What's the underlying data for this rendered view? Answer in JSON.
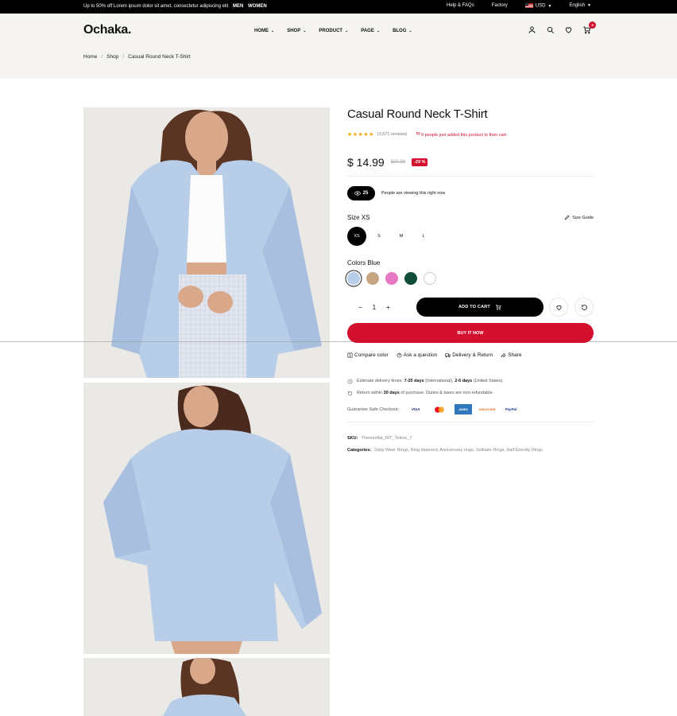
{
  "topbar": {
    "promo": "Up to 50% off Lorem ipsum dolor sit amet, consectetur adipiscing elit",
    "men": "MEN",
    "women": "WOMEN",
    "help": "Help & FAQs",
    "factory": "Factory",
    "currency": "USD",
    "language": "English"
  },
  "header": {
    "logo": "Ochaka.",
    "nav": [
      "HOME",
      "SHOP",
      "PRODUCT",
      "PAGE",
      "BLOG"
    ],
    "cart_count": "3"
  },
  "breadcrumb": [
    "Home",
    "Shop",
    "Casual Round Neck T-Shirt"
  ],
  "product": {
    "title": "Casual Round Neck T-Shirt",
    "stars": "★★★★★",
    "reviews": "(3,671 reviews)",
    "added": "9 people just added this product to their cart",
    "price": "$ 14.99",
    "old_price": "$39.99",
    "discount": "-29 %",
    "viewers": "25",
    "viewing_text": "People are viewing this right now",
    "size_label": "Size XS",
    "size_guide": "Size Guide",
    "sizes": [
      "XS",
      "S",
      "M",
      "L"
    ],
    "selected_size": "XS",
    "color_label": "Colors Blue",
    "colors": [
      "#b8cde8",
      "#c8a582",
      "#e578c2",
      "#114c38",
      "#ffffff"
    ],
    "selected_color": "#b8cde8",
    "quantity": "1",
    "add_to_cart": "ADD TO CART",
    "buy_now": "BUY IT NOW",
    "links": [
      "Compare color",
      "Ask a question",
      "Delivery & Return",
      "Share"
    ],
    "delivery_line1_pre": "Estimate delivery times:",
    "delivery_intl": "7-20 days",
    "delivery_intl_suffix": "(International),",
    "delivery_us": "2-6 days",
    "delivery_us_suffix": "(United States).",
    "return_pre": "Return within",
    "return_days": "30 days",
    "return_post": "of purchase. Duties & taxes are non-refundable.",
    "checkout_label": "Guarantee Safe Checkout:",
    "payments": [
      "VISA",
      "mastercard",
      "AMEX",
      "DISCOVER",
      "PayPal"
    ],
    "sku_label": "SKU:",
    "sku": "Themesflat_IRT_Yellow_7",
    "categories_label": "Categories:",
    "categories": "Daily Wear Rings, Ring diamond, Anniversary rings, Solitaire Rings, Half Eternity Rings"
  }
}
